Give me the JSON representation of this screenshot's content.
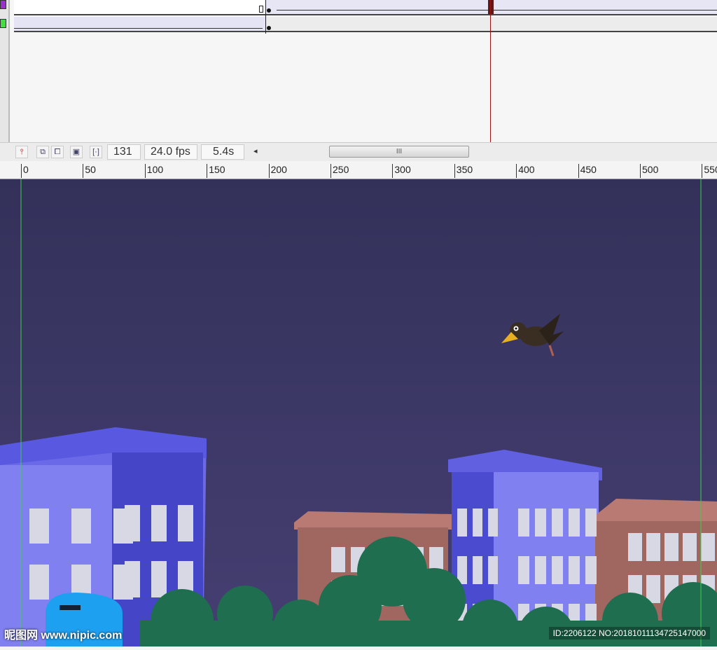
{
  "timeline": {
    "layer_colors": [
      "#9b30d0",
      "#40e040"
    ],
    "playhead_color": "#a01010"
  },
  "toolbar": {
    "current_frame": "131",
    "frame_rate": "24.0 fps",
    "elapsed_time": "5.4s",
    "scroll_arrow": "◂",
    "scroll_grip": "III",
    "icons": [
      "center-frame-icon",
      "onion-skin-icon",
      "onion-skin-outlines-icon",
      "edit-multiple-frames-icon",
      "modify-onion-markers-icon"
    ]
  },
  "ruler": {
    "labels": [
      "0",
      "50",
      "100",
      "150",
      "200",
      "250",
      "300",
      "350",
      "400",
      "450",
      "500",
      "550"
    ]
  },
  "watermark": {
    "left": "昵图网 www.nipic.com",
    "right": "ID:2206122 NO:20181011134725147000"
  }
}
